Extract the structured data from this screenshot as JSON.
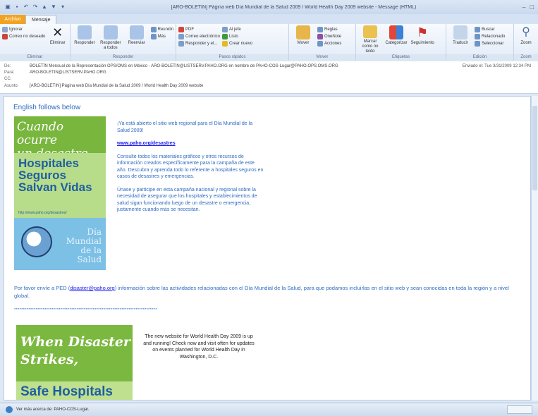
{
  "window": {
    "title": "[ARO-BOLETIN] Página web Día Mundial de la Salud 2009 / World Health Day 2009 website - Message (HTML)"
  },
  "tabs": [
    "Archivo",
    "Mensaje"
  ],
  "ribbon": {
    "groups": [
      {
        "label": "Eliminar",
        "buttons": [
          "Ignorar",
          "Limpiar",
          "Correo no deseado",
          "Eliminar"
        ]
      },
      {
        "label": "Responder",
        "buttons": [
          "Responder",
          "Responder a todos",
          "Reenviar",
          "Reunión",
          "Más"
        ]
      },
      {
        "label": "Pasos rápidos",
        "buttons": [
          "PDF",
          "Correo electrónico",
          "Responder y el...",
          "Al jefe",
          "Listo",
          "Crear nuevo"
        ]
      },
      {
        "label": "Mover",
        "buttons": [
          "Mover",
          "Reglas",
          "OneNote",
          "Acciones"
        ]
      },
      {
        "label": "Etiquetas",
        "buttons": [
          "Marcar como no leído",
          "Categorizar",
          "Seguimiento"
        ]
      },
      {
        "label": "Edición",
        "buttons": [
          "Traducir",
          "Buscar",
          "Relacionado",
          "Seleccionar"
        ]
      },
      {
        "label": "Zoom",
        "buttons": [
          "Zoom"
        ]
      }
    ]
  },
  "header": {
    "from_label": "De:",
    "from": "BOLETÍN Mensual de la Representación OPS/OMS en México - ARO-BOLETIN@LISTSERV.PAHO.ORG en nombre de PAHO-COS-Lugar@PAHO.OPS.OMS.ORG",
    "to_label": "Para:",
    "to": "ARO-BOLETIN@LISTSERV.PAHO.ORG",
    "cc_label": "CC:",
    "cc": "",
    "subject_label": "Asunto:",
    "subject": "[ARO-BOLETIN] Página web Día Mundial de la Salud 2009 / World Health Day 2009 website",
    "sent_label": "Enviado el:",
    "sent": "Tue 3/31/2009 12:34 PM"
  },
  "body": {
    "english_follows": "English follows below",
    "poster_es": {
      "line1": "Cuando ocurre",
      "line2": "un desastre,",
      "line3": "Hospitales",
      "line4": "Seguros",
      "line5": "Salvan Vidas",
      "url": "http://www.paho.org/desastres/",
      "dia1": "Día",
      "dia2": "Mundial",
      "dia3": "de la",
      "dia4": "Salud"
    },
    "es_intro": "¡Ya está abierto el sitio web regional para el Día Mundial de la Salud 2009!",
    "es_link": "www.paho.org/desastres",
    "es_para1": "Consulte todos los materiales gráficos y otros recursos de información creados específicamente para la campaña de este año. Descubra y aprenda todo lo referente a hospitales seguros en casos de desastres y emergencias.",
    "es_para2": "Únase y participe en esta campaña nacional y regional sobre la necesidad de asegurar que los hospitales y establecimientos de salud sigan funcionando luego de un desastre o emergencia, justamente cuando más se necesitan.",
    "notice_pre": "Por favor envíe a PED (",
    "notice_link": "disaster@paho.org",
    "notice_post": ") información sobre las actividades relacionadas con el Día Mundial de la Salud, para que podamos incluirlas en el sitio web y sean conocidas en toda la región y a nivel global.",
    "separator": "********************************************************************************",
    "poster_en": {
      "line1": "When Disaster",
      "line2": "Strikes,",
      "line3": "Safe Hospitals"
    },
    "en_text": "The new website for World Health Day 2009 is up and running! Check now and visit often for updates on events planned for World Health Day in Washington, D.C."
  },
  "status": {
    "text": "Ver más acerca de: PAHO-COS-Lugar."
  }
}
